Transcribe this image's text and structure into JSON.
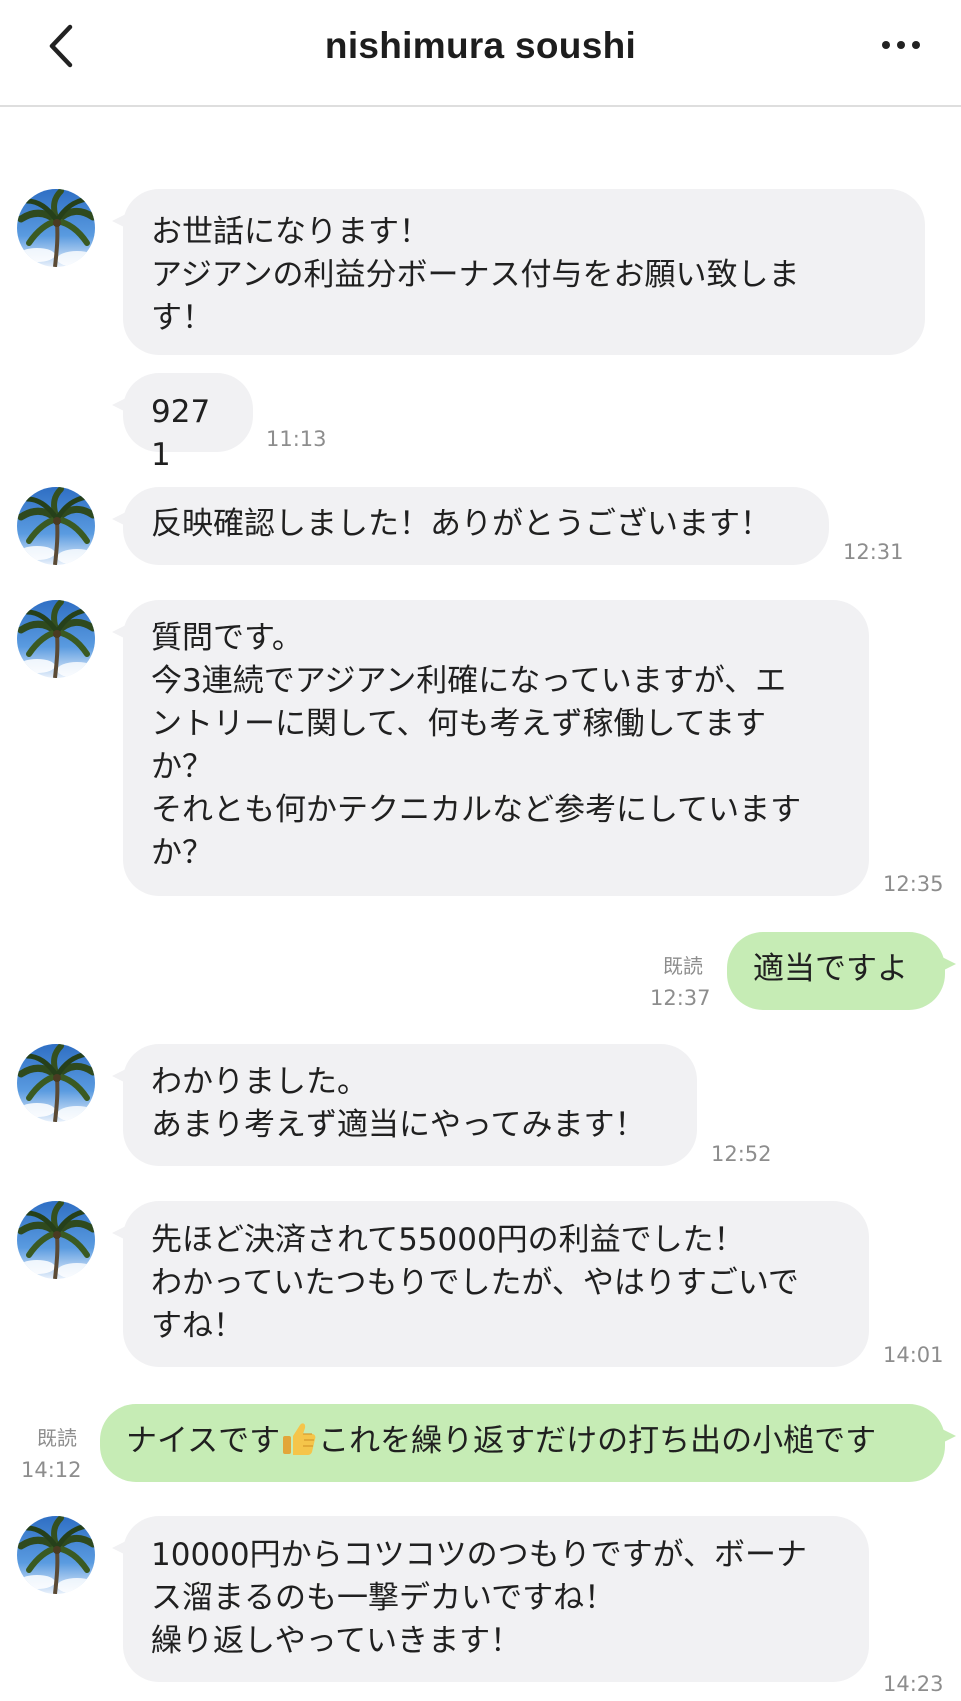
{
  "header": {
    "title": "nishimura soushi",
    "back_icon": "chevron-left-icon",
    "more_icon": "more-dots-icon"
  },
  "colors": {
    "incoming_bubble": "#f1f1f3",
    "outgoing_bubble": "#c6ecb5",
    "timestamp": "#8d8d8d"
  },
  "messages": [
    {
      "sender": "nishimura soushi",
      "text": "お世話になります！\nアジアンの利益分ボーナス付与をお願い致しま\nす！",
      "time": ""
    },
    {
      "sender": "nishimura soushi",
      "text": "9271",
      "time": "11:13"
    },
    {
      "sender": "nishimura soushi",
      "text": "反映確認しました！ありがとうございます！",
      "time": "12:31"
    },
    {
      "sender": "nishimura soushi",
      "text": "質問です。\n今3連続でアジアン利確になっていますが、エ\nントリーに関して、何も考えず稼働してます\nか？\nそれとも何かテクニカルなど参考にしています\nか？",
      "time": "12:35"
    },
    {
      "sender": "me",
      "text": "適当ですよ",
      "read": "既読",
      "time": "12:37"
    },
    {
      "sender": "nishimura soushi",
      "text": "わかりました。\nあまり考えず適当にやってみます！",
      "time": "12:52"
    },
    {
      "sender": "nishimura soushi",
      "text": "先ほど決済されて55000円の利益でした！\nわかっていたつもりでしたが、やはりすごいで\nすね！",
      "time": "14:01"
    },
    {
      "sender": "me",
      "text_before": "ナイスです",
      "emoji": "thumbs-up-icon",
      "text_after": "これを繰り返すだけの打ち出の小槌です",
      "read": "既読",
      "time": "14:12"
    },
    {
      "sender": "nishimura soushi",
      "text": "10000円からコツコツのつもりですが、ボーナ\nス溜まるのも一撃デカいですね！\n繰り返しやっていきます！",
      "time": "14:23"
    }
  ]
}
